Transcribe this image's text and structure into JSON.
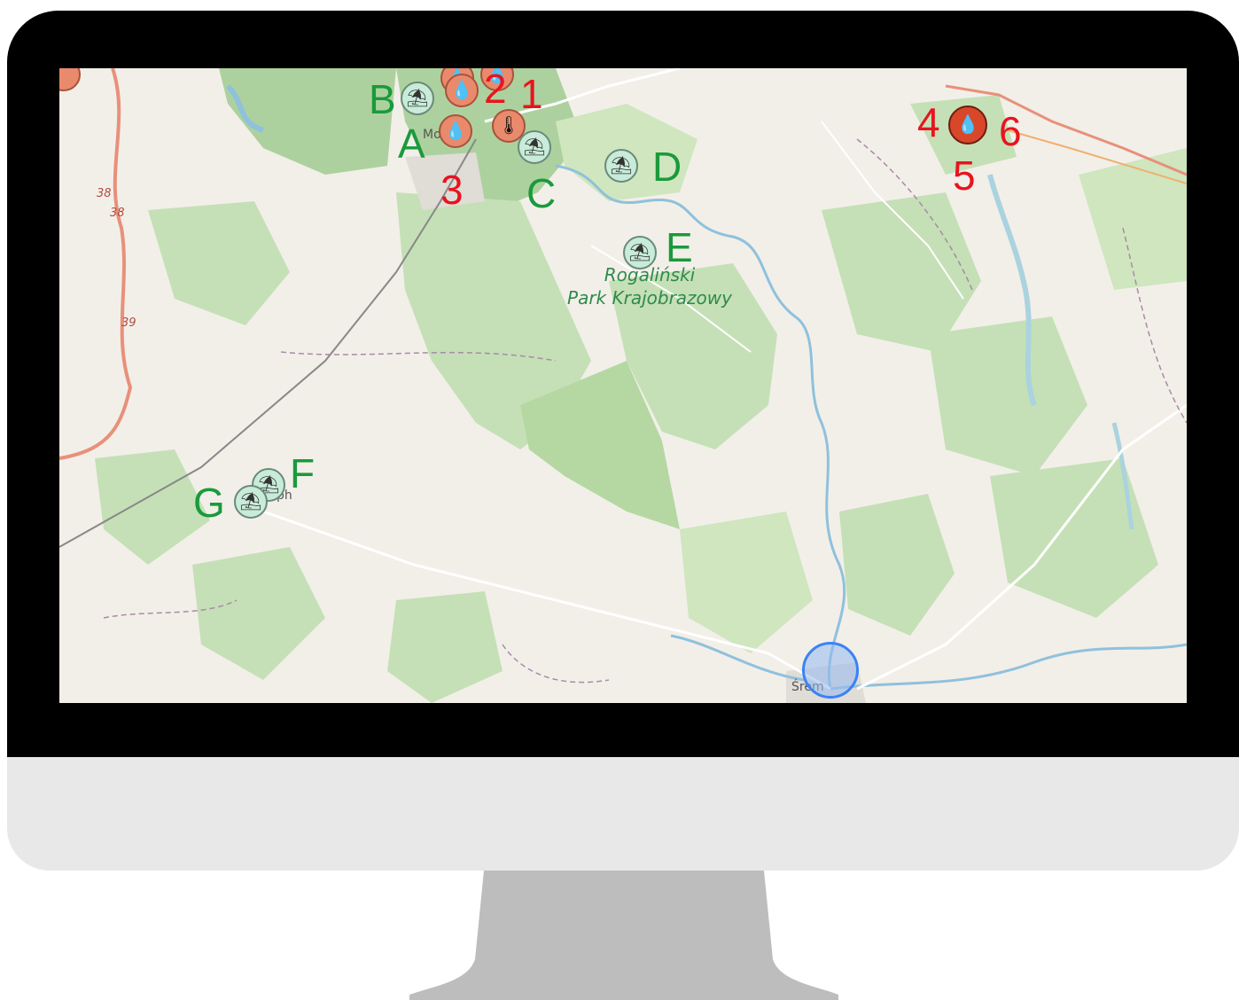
{
  "map": {
    "park_name_line1": "Rogaliński",
    "park_name_line2": "Park Krajobrazowy",
    "places": {
      "mosina": "Mo",
      "srem": "Śrem",
      "stęszew_fragment": "ph"
    },
    "road_numbers": [
      "38",
      "38",
      "39"
    ],
    "markers": [
      {
        "label": "A",
        "kind": "beach",
        "icon": "beach-umbrella-icon"
      },
      {
        "label": "B",
        "kind": "beach",
        "icon": "beach-umbrella-icon"
      },
      {
        "label": "C",
        "kind": "beach",
        "icon": "beach-umbrella-icon"
      },
      {
        "label": "D",
        "kind": "beach",
        "icon": "beach-umbrella-icon"
      },
      {
        "label": "E",
        "kind": "beach",
        "icon": "beach-umbrella-icon"
      },
      {
        "label": "F",
        "kind": "beach",
        "icon": "beach-umbrella-icon"
      },
      {
        "label": "G",
        "kind": "beach",
        "icon": "beach-umbrella-icon"
      },
      {
        "label": "1",
        "kind": "heat",
        "icon": "thermometer-sun-icon"
      },
      {
        "label": "2",
        "kind": "rain",
        "icon": "water-drop-icon"
      },
      {
        "label": "3",
        "kind": "rain",
        "icon": "water-drop-icon"
      },
      {
        "label": "4",
        "kind": "fire",
        "icon": "water-drop-icon"
      },
      {
        "label": "5",
        "kind": "fire",
        "icon": "water-drop-icon"
      },
      {
        "label": "6",
        "kind": "fire",
        "icon": "water-drop-icon"
      }
    ],
    "colors": {
      "label_green": "#1a9a3c",
      "label_red": "#e8141e",
      "beach_marker": "#c8ecd9",
      "hot_marker": "#e98a6c",
      "fire_marker": "#d9472b",
      "location_ring": "#3b82f6",
      "forest": "#add19e",
      "land": "#f2efe9",
      "water": "#aad3df"
    }
  }
}
